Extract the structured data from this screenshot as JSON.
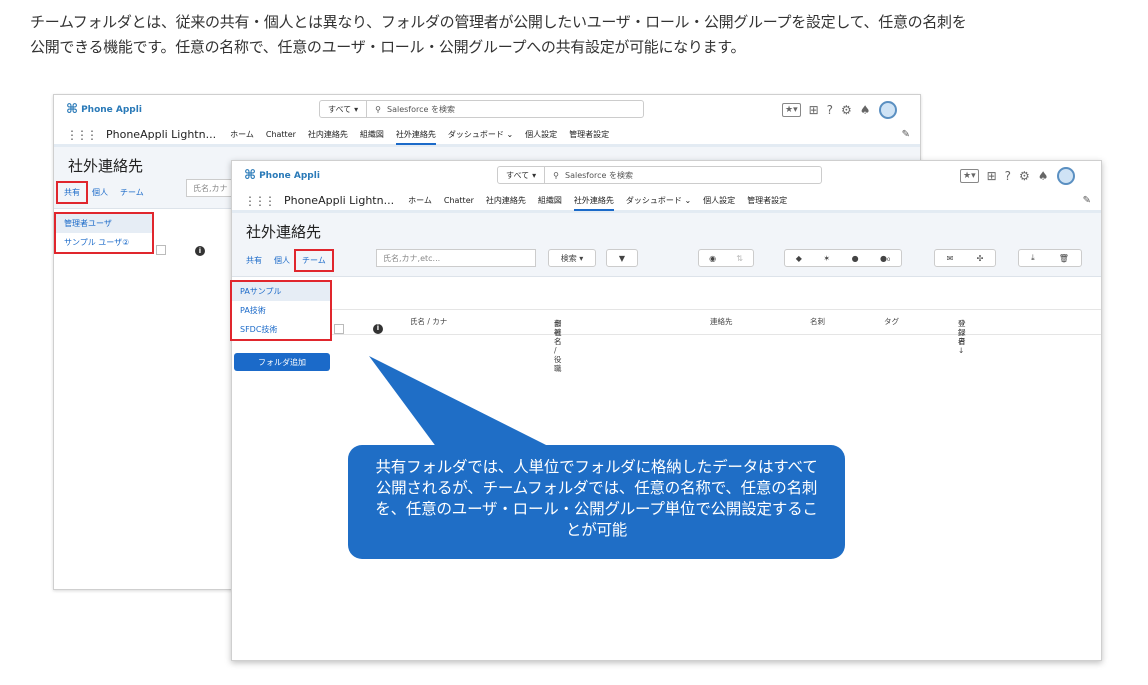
{
  "intro": {
    "line1": "チームフォルダとは、従来の共有・個人とは異なり、フォルダの管理者が公開したいユーザ・ロール・公開グループを設定して、任意の名刺を",
    "line2": "公開できる機能です。任意の名称で、任意のユーザ・ロール・公開グループへの共有設定が可能になります。"
  },
  "app": {
    "logo": "Phone Appli",
    "scope": "すべて",
    "search_placeholder": "Salesforce を検索",
    "app_name": "PhoneAppli Lightn...",
    "nav": [
      "ホーム",
      "Chatter",
      "社内連絡先",
      "組織図",
      "社外連絡先",
      "ダッシュボード",
      "個人設定",
      "管理者設定"
    ],
    "page_title": "社外連絡先"
  },
  "back_screen": {
    "tabs": [
      "共有",
      "個人",
      "チーム"
    ],
    "filter_placeholder": "氏名,カナ",
    "folders": [
      "管理者ユーザ",
      "サンプル ユーザ②"
    ]
  },
  "front_screen": {
    "tabs": [
      "共有",
      "個人",
      "チーム"
    ],
    "filter_placeholder": "氏名,カナ,etc...",
    "search_button": "検索",
    "folders": [
      "PAサンプル",
      "PA技術",
      "SFDC技術"
    ],
    "add_folder_button": "フォルダ追加",
    "columns": {
      "name": "氏名 / カナ",
      "company": "会社名",
      "department": "部署名 / 役職",
      "contact": "連絡先",
      "card": "名刺",
      "tag": "タグ",
      "registrant": "登録者",
      "reg_date": "登録日 ↓"
    }
  },
  "callout": {
    "text": "共有フォルダでは、人単位でフォルダに格納したデータはすべて公開されるが、チームフォルダでは、任意の名称で、任意の名刺を、任意のユーザ・ロール・公開グループ単位で公開設定することが可能"
  },
  "colors": {
    "accent": "#1b6ac9",
    "callout": "#1f6ec6",
    "highlight": "#e0262d"
  }
}
